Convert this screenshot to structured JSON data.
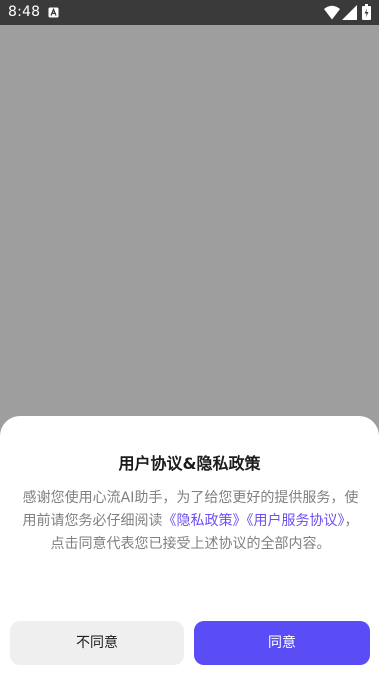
{
  "status_bar": {
    "time": "8:48",
    "icons": [
      "a-notification-icon",
      "wifi-icon",
      "cellular-signal-icon",
      "battery-icon"
    ]
  },
  "dialog": {
    "title": "用户协议&隐私政策",
    "body_part1": "感谢您使用心流AI助手，为了给您更好的提供服务，使用前请您务必仔细阅读",
    "privacy_link": "《隐私政策》",
    "user_agreement_link": "《用户服务协议》",
    "body_part2": "，点击同意代表您已接受上述协议的全部内容。",
    "decline_label": "不同意",
    "agree_label": "同意"
  },
  "colors": {
    "scrim": "#9e9e9e",
    "accent": "#5a4df5",
    "link": "#6f4ef2",
    "decline_bg": "#efefef"
  }
}
